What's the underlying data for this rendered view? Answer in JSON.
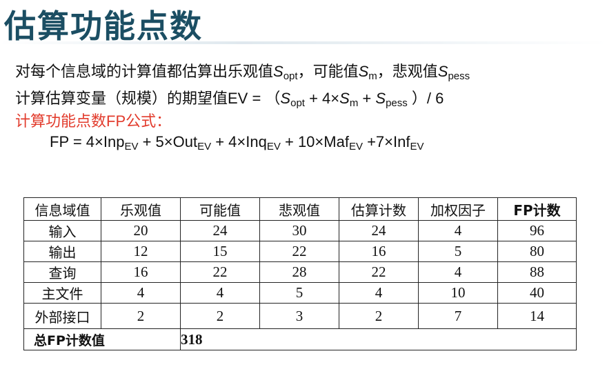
{
  "title": "估算功能点数",
  "formula_lines": {
    "line1_a": "对每个信息域的计算值都估算出乐观值",
    "line1_s": "S",
    "line1_sub_opt": "opt",
    "line1_b": "，可能值",
    "line1_sub_m": "m",
    "line1_c": "，悲观值",
    "line1_sub_pess": "pess",
    "line2_a": "计算估算变量（规模）的期望值EV = （",
    "line2_s1": "S",
    "line2_sub1": "opt",
    "line2_b": " + 4×",
    "line2_s2": "S",
    "line2_sub2": "m",
    "line2_c": " + ",
    "line2_s3": "S",
    "line2_sub3": "pess",
    "line2_d": " ）/ 6",
    "line3": "计算功能点数FP公式：",
    "line4_a": "FP = 4×Inp",
    "line4_b": " + 5×Out",
    "line4_c": " + 4×Inq",
    "line4_d": " + 10×Maf",
    "line4_e": " +7×Inf",
    "sub_ev": "EV"
  },
  "table": {
    "headers": [
      "信息域值",
      "乐观值",
      "可能值",
      "悲观值",
      "估算计数",
      "加权因子",
      "FP计数"
    ],
    "rows": [
      [
        "输入",
        "20",
        "24",
        "30",
        "24",
        "4",
        "96"
      ],
      [
        "输出",
        "12",
        "15",
        "22",
        "16",
        "5",
        "80"
      ],
      [
        "查询",
        "16",
        "22",
        "28",
        "22",
        "4",
        "88"
      ],
      [
        "主文件",
        "4",
        "4",
        "5",
        "4",
        "10",
        "40"
      ],
      [
        "外部接口",
        "2",
        "2",
        "3",
        "2",
        "7",
        "14"
      ]
    ],
    "total_label": "总FP计数值",
    "total_value": "318"
  },
  "colors": {
    "title": "#1b4e63",
    "highlight": "#e23b2c"
  }
}
